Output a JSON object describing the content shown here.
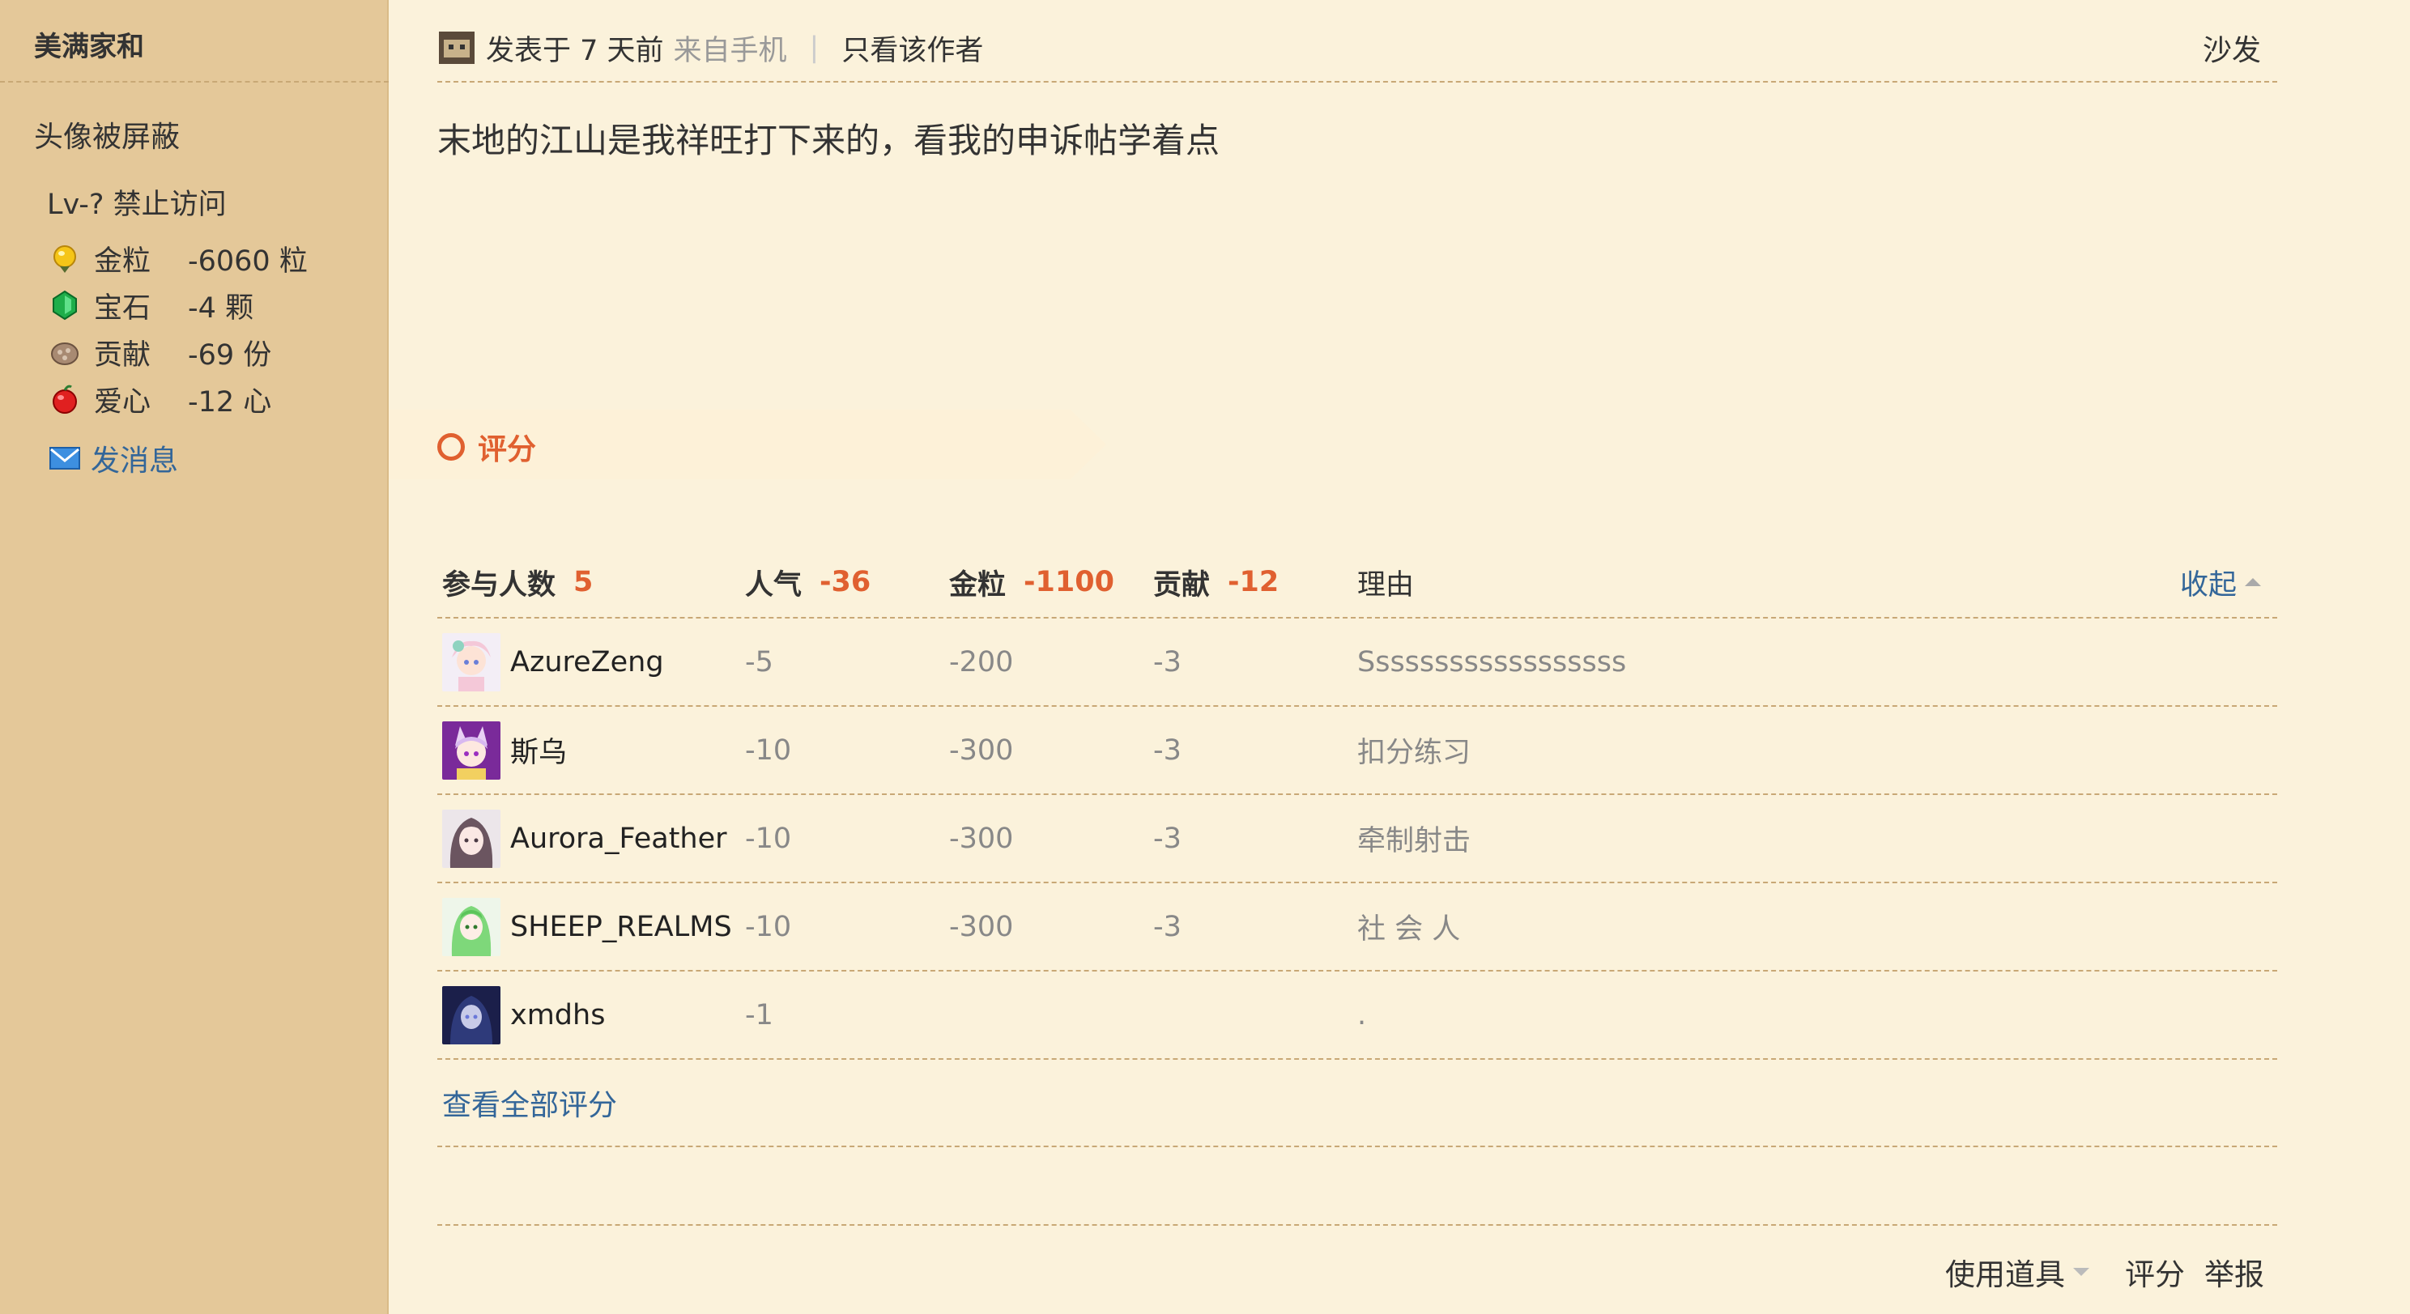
{
  "sidebar": {
    "username": "美满家和",
    "avatar_note": "头像被屏蔽",
    "level": "Lv-? 禁止访问",
    "stats": [
      {
        "label": "金粒",
        "value": "-6060 粒",
        "icon": "gold-grain-icon"
      },
      {
        "label": "宝石",
        "value": "-4 颗",
        "icon": "gem-icon"
      },
      {
        "label": "贡献",
        "value": "-69 份",
        "icon": "contribution-icon"
      },
      {
        "label": "爱心",
        "value": "-12 心",
        "icon": "heart-apple-icon"
      }
    ],
    "send_message": "发消息"
  },
  "post": {
    "posted": "发表于 7 天前",
    "source": "来自手机",
    "separator": "|",
    "author_only": "只看该作者",
    "floor": "沙发",
    "content": "末地的江山是我祥旺打下来的，看我的申诉帖学着点"
  },
  "rating": {
    "title": "评分",
    "header": {
      "participants_label": "参与人数",
      "participants_value": "5",
      "popularity_label": "人气",
      "popularity_value": "-36",
      "gold_label": "金粒",
      "gold_value": "-1100",
      "contribution_label": "贡献",
      "contribution_value": "-12",
      "reason_label": "理由",
      "collapse": "收起"
    },
    "rows": [
      {
        "user": "AzureZeng",
        "popularity": "-5",
        "gold": "-200",
        "contribution": "-3",
        "reason": "Ssssssssssssssssss"
      },
      {
        "user": "斯乌",
        "popularity": "-10",
        "gold": "-300",
        "contribution": "-3",
        "reason": "扣分练习"
      },
      {
        "user": "Aurora_Feather",
        "popularity": "-10",
        "gold": "-300",
        "contribution": "-3",
        "reason": "牵制射击"
      },
      {
        "user": "SHEEP_REALMS",
        "popularity": "-10",
        "gold": "-300",
        "contribution": "-3",
        "reason": "社 会 人"
      },
      {
        "user": "xmdhs",
        "popularity": "-1",
        "gold": "",
        "contribution": "",
        "reason": "."
      }
    ],
    "view_all": "查看全部评分"
  },
  "actions": {
    "use_tool": "使用道具",
    "rate": "评分",
    "report": "举报"
  },
  "colors": {
    "sidebar_bg": "#e4c899",
    "page_bg": "#fbf2db",
    "accent": "#e06030",
    "link": "#336699"
  }
}
